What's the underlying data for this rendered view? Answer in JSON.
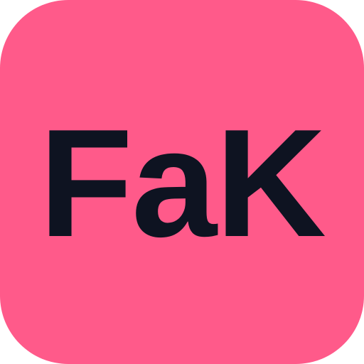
{
  "icon": {
    "text": "FaK",
    "background_color": "#FF5A8A",
    "text_color": "#0E1321"
  }
}
